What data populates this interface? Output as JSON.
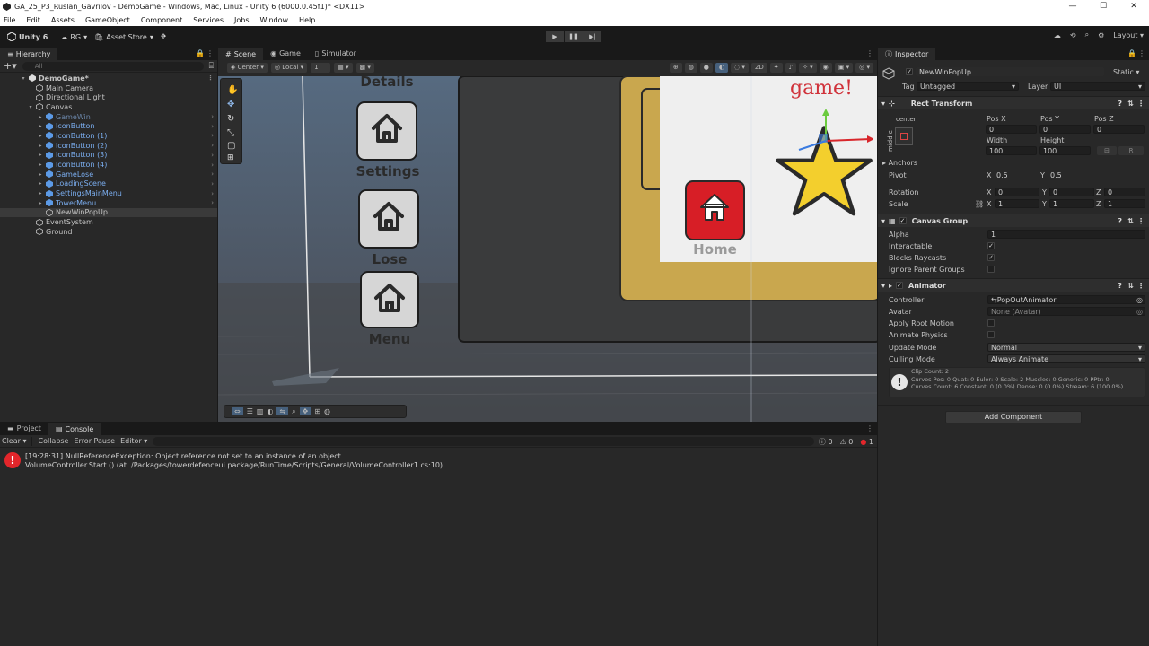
{
  "titlebar": {
    "title": "GA_25_P3_Ruslan_Gavrilov - DemoGame - Windows, Mac, Linux - Unity 6 (6000.0.45f1)* <DX11>",
    "controls": [
      "—",
      "☐",
      "✕"
    ]
  },
  "menubar": {
    "items": [
      "File",
      "Edit",
      "Assets",
      "GameObject",
      "Component",
      "Services",
      "Jobs",
      "Window",
      "Help"
    ]
  },
  "toolbar": {
    "unity_label": "Unity 6",
    "account_label": "RG",
    "asset_store_label": "Asset Store",
    "layout_label": "Layout"
  },
  "hierarchy": {
    "tab_label": "Hierarchy",
    "search_placeholder": "All",
    "scene_name": "DemoGame*",
    "items": [
      {
        "label": "Main Camera",
        "indent": 2,
        "kind": "go"
      },
      {
        "label": "Directional Light",
        "indent": 2,
        "kind": "go"
      },
      {
        "label": "Canvas",
        "indent": 2,
        "kind": "go",
        "expanded": true
      },
      {
        "label": "GameWin",
        "indent": 3,
        "kind": "prefab-dim"
      },
      {
        "label": "IconButton",
        "indent": 3,
        "kind": "prefab"
      },
      {
        "label": "IconButton (1)",
        "indent": 3,
        "kind": "prefab"
      },
      {
        "label": "IconButton (2)",
        "indent": 3,
        "kind": "prefab"
      },
      {
        "label": "IconButton (3)",
        "indent": 3,
        "kind": "prefab"
      },
      {
        "label": "IconButton (4)",
        "indent": 3,
        "kind": "prefab"
      },
      {
        "label": "GameLose",
        "indent": 3,
        "kind": "prefab"
      },
      {
        "label": "LoadingScene",
        "indent": 3,
        "kind": "prefab"
      },
      {
        "label": "SettingsMainMenu",
        "indent": 3,
        "kind": "prefab"
      },
      {
        "label": "TowerMenu",
        "indent": 3,
        "kind": "prefab"
      },
      {
        "label": "NewWinPopUp",
        "indent": 3,
        "kind": "go-selected"
      },
      {
        "label": "EventSystem",
        "indent": 2,
        "kind": "go"
      },
      {
        "label": "Ground",
        "indent": 2,
        "kind": "go"
      }
    ]
  },
  "scene": {
    "tabs": [
      "Scene",
      "Game",
      "Simulator"
    ],
    "pivot_label": "Center",
    "space_label": "Local",
    "grid_value": "1",
    "buttons": [
      "Details",
      "Settings",
      "Lose",
      "Menu"
    ],
    "popup_title": "game!",
    "home_label": "Home"
  },
  "console": {
    "tabs": [
      "Project",
      "Console"
    ],
    "tool_labels": [
      "Clear",
      "Collapse",
      "Error Pause",
      "Editor"
    ],
    "counts": {
      "log": "0",
      "warn": "0",
      "error": "1"
    },
    "log_line1": "[19:28:31] NullReferenceException: Object reference not set to an instance of an object",
    "log_line2": "VolumeController.Start () (at ./Packages/towerdefenceui.package/RunTime/Scripts/General/VolumeController1.cs:10)"
  },
  "inspector": {
    "tab_label": "Inspector",
    "object_name": "NewWinPopUp",
    "static_label": "Static",
    "tag_label": "Tag",
    "tag_value": "Untagged",
    "layer_label": "Layer",
    "layer_value": "UI",
    "rect_transform": {
      "title": "Rect Transform",
      "anchor_preset_top": "center",
      "anchor_preset_side": "middle",
      "posx_label": "Pos X",
      "posy_label": "Pos Y",
      "posz_label": "Pos Z",
      "posx": "0",
      "posy": "0",
      "posz": "0",
      "width_label": "Width",
      "height_label": "Height",
      "width": "100",
      "height": "100",
      "anchors_label": "Anchors",
      "pivot_label": "Pivot",
      "pivot_x": "0.5",
      "pivot_y": "0.5",
      "rotation_label": "Rotation",
      "rot_x": "0",
      "rot_y": "0",
      "rot_z": "0",
      "scale_label": "Scale",
      "scale_x": "1",
      "scale_y": "1",
      "scale_z": "1",
      "axis_x": "X",
      "axis_y": "Y",
      "axis_z": "Z",
      "raw_button": "R"
    },
    "canvas_group": {
      "title": "Canvas Group",
      "alpha_label": "Alpha",
      "alpha": "1",
      "interactable_label": "Interactable",
      "interactable": true,
      "blocks_label": "Blocks Raycasts",
      "blocks": true,
      "ignore_label": "Ignore Parent Groups",
      "ignore": false
    },
    "animator": {
      "title": "Animator",
      "controller_label": "Controller",
      "controller": "PopOutAnimator",
      "avatar_label": "Avatar",
      "avatar": "None (Avatar)",
      "root_motion_label": "Apply Root Motion",
      "physics_label": "Animate Physics",
      "update_label": "Update Mode",
      "update_mode": "Normal",
      "culling_label": "Culling Mode",
      "culling_mode": "Always Animate",
      "info_line1": "Clip Count: 2",
      "info_line2": "Curves Pos: 0 Quat: 0 Euler: 0 Scale: 2 Muscles: 0 Generic: 0 PPtr: 0",
      "info_line3": "Curves Count: 6 Constant: 0 (0.0%) Dense: 0 (0.0%) Stream: 6 (100.0%)"
    },
    "add_component": "Add Component"
  },
  "colors": {
    "accent": "#3a79bb",
    "error": "#e3262b",
    "prefab": "#7baef0"
  }
}
